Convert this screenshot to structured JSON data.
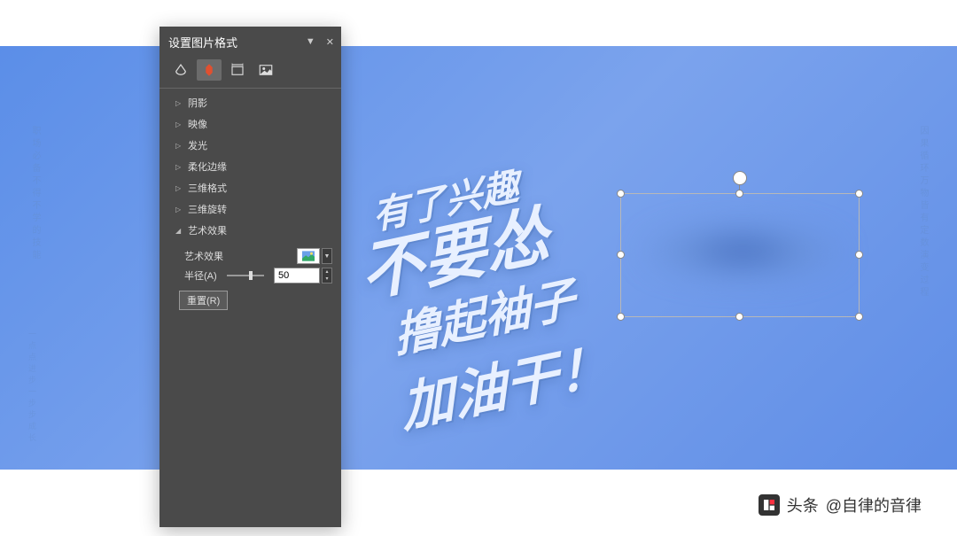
{
  "panel": {
    "title": "设置图片格式",
    "tabs": {
      "fill": "fill-icon",
      "effects": "effects-icon",
      "size": "size-icon",
      "picture": "picture-icon",
      "active": 1
    },
    "sections": [
      {
        "label": "阴影",
        "expanded": false
      },
      {
        "label": "映像",
        "expanded": false
      },
      {
        "label": "发光",
        "expanded": false
      },
      {
        "label": "柔化边缘",
        "expanded": false
      },
      {
        "label": "三维格式",
        "expanded": false
      },
      {
        "label": "三维旋转",
        "expanded": false
      },
      {
        "label": "艺术效果",
        "expanded": true
      }
    ],
    "artistic": {
      "effect_label": "艺术效果",
      "radius_label": "半径(A)",
      "radius_value": "50",
      "reset_label": "重置(R)"
    }
  },
  "canvas": {
    "main_text": {
      "line1": "有了兴趣",
      "line2": "不要怂",
      "line3": "撸起袖子",
      "line4": "加油干！"
    },
    "side_left": "职场必备不得不学的技能",
    "side_right": "因果循环万物皆有定数演变过程",
    "side_extra": "一点点进步一步步成长"
  },
  "watermark": {
    "prefix": "头条",
    "author": "@自律的音律"
  }
}
